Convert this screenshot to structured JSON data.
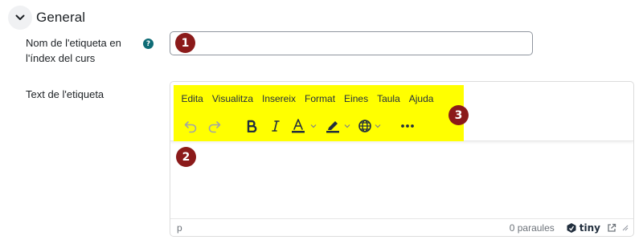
{
  "section": {
    "title": "General",
    "collapse_icon": "chevron-down-icon"
  },
  "name_field": {
    "label": "Nom de l'etiqueta en l'índex del curs",
    "help_icon": "question-circle-icon",
    "value": "",
    "badge": "1"
  },
  "text_field": {
    "label": "Text de l'etiqueta",
    "badge_body": "2",
    "badge_toolbar": "3"
  },
  "editor": {
    "menu": [
      "Edita",
      "Visualitza",
      "Insereix",
      "Format",
      "Eines",
      "Taula",
      "Ajuda"
    ],
    "toolbar_icons": [
      "undo-icon",
      "redo-icon",
      "bold-icon",
      "italic-icon",
      "text-color-icon",
      "highlight-icon",
      "language-icon",
      "more-icon"
    ],
    "status_path": "p",
    "word_count": "0 paraules",
    "brand": "tiny"
  },
  "colors": {
    "highlight": "#ffff00",
    "badge": "#8b1a1a",
    "help": "#0f6c76",
    "tiny_blue": "#335dff"
  }
}
